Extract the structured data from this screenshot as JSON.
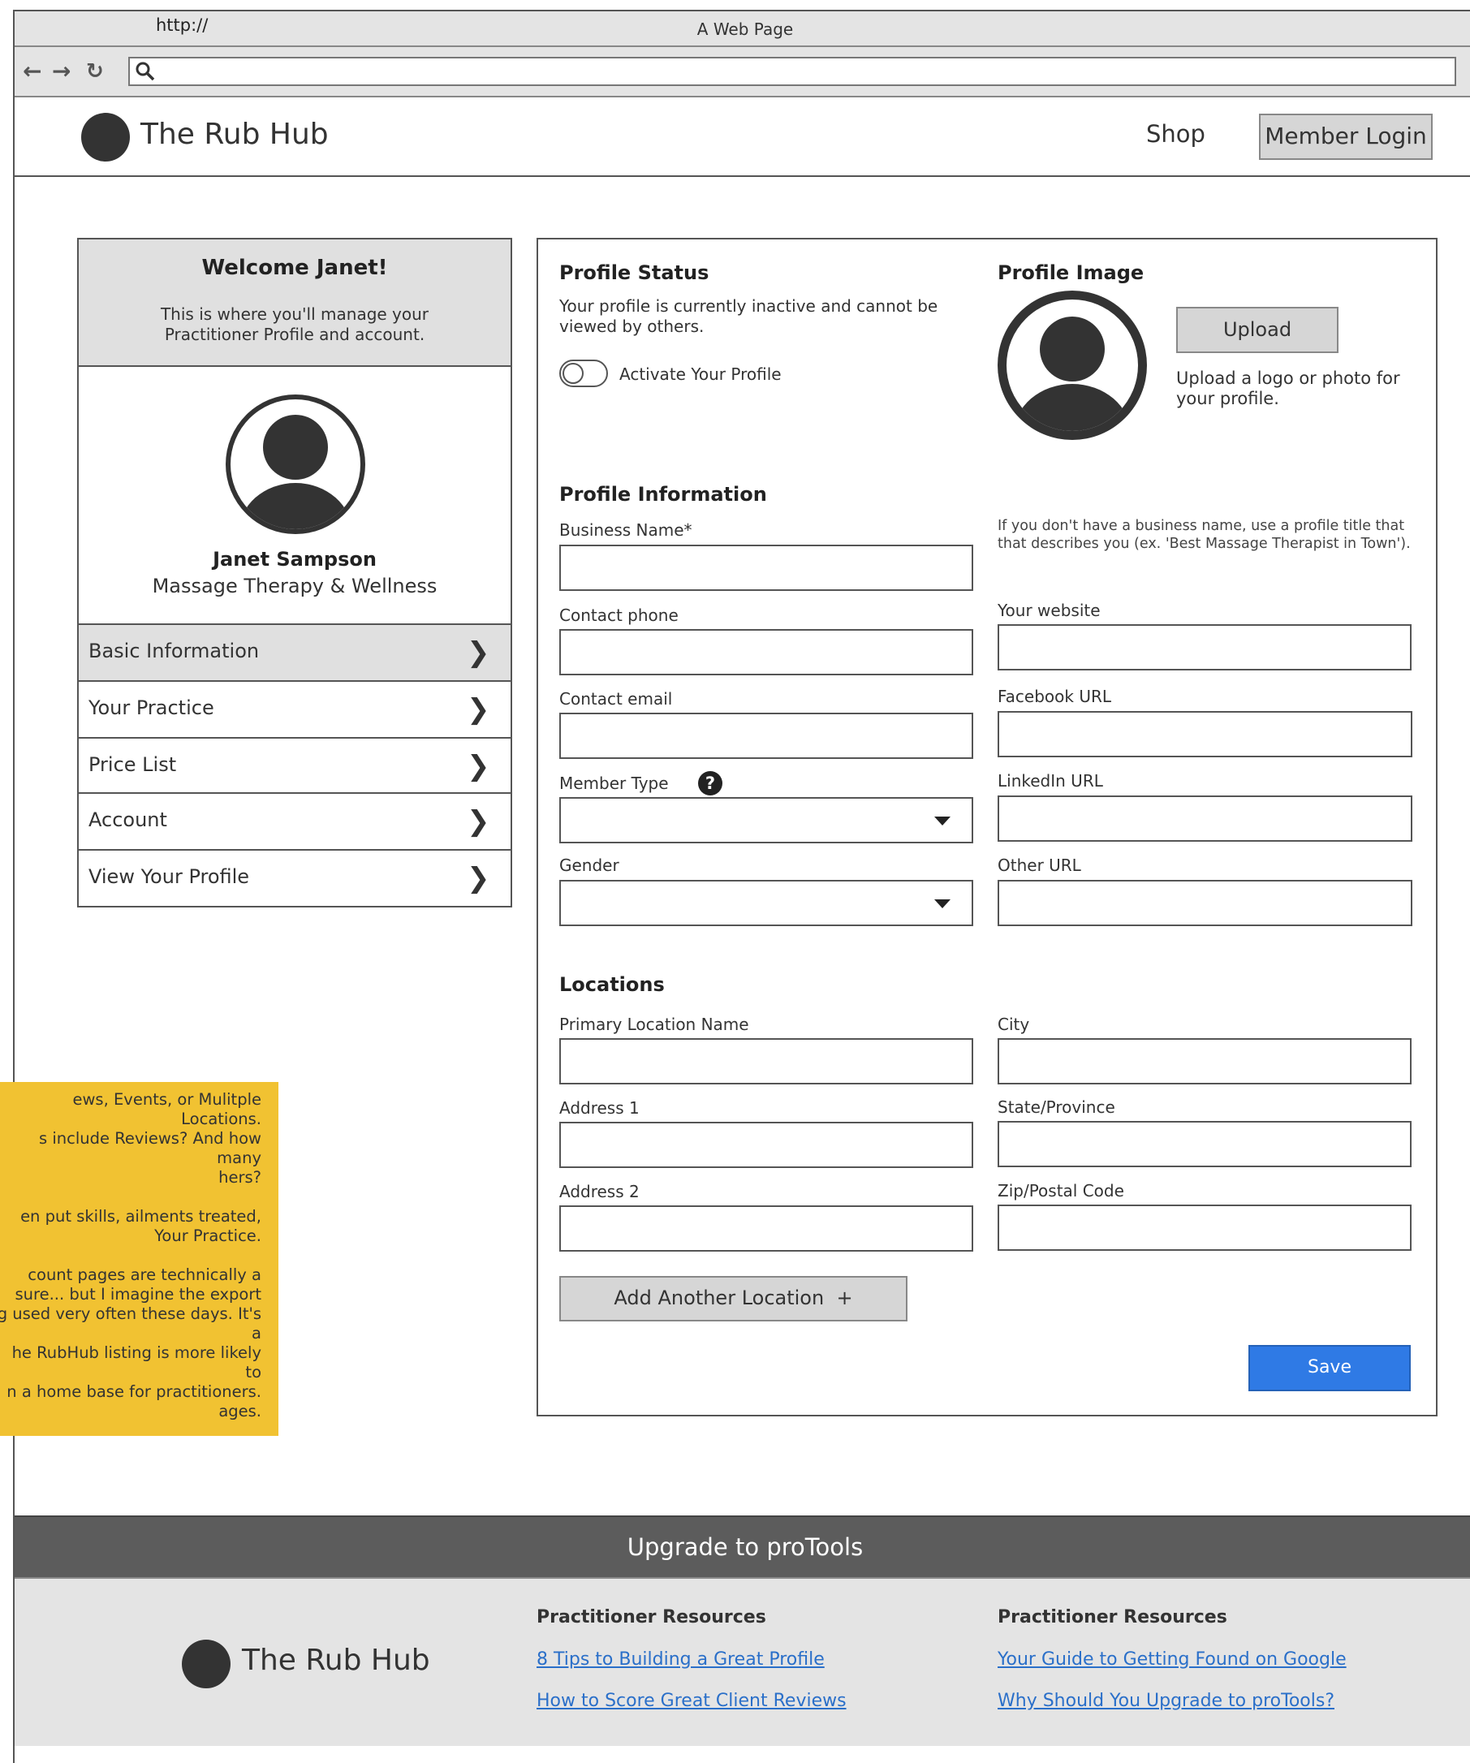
{
  "browser": {
    "title": "A Web Page",
    "url": "http://",
    "back_icon": "arrow-left",
    "forward_icon": "arrow-right",
    "reload_icon": "reload"
  },
  "header": {
    "brand": "The Rub Hub",
    "shop_label": "Shop",
    "login_label": "Member Login"
  },
  "sidebar": {
    "welcome_title": "Welcome Janet!",
    "welcome_text": "This is where you'll manage your Practitioner Profile and account.",
    "name": "Janet Sampson",
    "subtitle": "Massage Therapy & Wellness",
    "items": [
      {
        "label": "Basic Information",
        "active": true
      },
      {
        "label": "Your Practice"
      },
      {
        "label": "Price List"
      },
      {
        "label": "Account"
      },
      {
        "label": "View Your Profile"
      }
    ]
  },
  "profile_status": {
    "heading": "Profile Status",
    "text": "Your profile is currently inactive and cannot be viewed by others.",
    "toggle_label": "Activate Your Profile"
  },
  "profile_image": {
    "heading": "Profile Image",
    "upload_label": "Upload",
    "hint": "Upload a logo or photo for your profile."
  },
  "profile_info": {
    "heading": "Profile Information",
    "business_name_label": "Business Name*",
    "business_hint": "If you don't have a business name, use a profile title that that describes you (ex. 'Best Massage Therapist in Town').",
    "contact_phone_label": "Contact phone",
    "contact_email_label": "Contact email",
    "member_type_label": "Member Type",
    "gender_label": "Gender",
    "website_label": "Your website",
    "facebook_label": "Facebook URL",
    "linkedin_label": "LinkedIn URL",
    "other_label": "Other URL"
  },
  "locations": {
    "heading": "Locations",
    "primary_label": "Primary Location Name",
    "address1_label": "Address 1",
    "address2_label": "Address 2",
    "city_label": "City",
    "state_label": "State/Province",
    "zip_label": "Zip/Postal Code",
    "add_label": "Add Another Location  +"
  },
  "save_label": "Save",
  "sticky_note": "ews, Events, or Mulitple Locations.\ns include Reviews? And how many\nhers?\n\nen put skills, ailments treated,\n Your Practice.\n\ncount pages are technically a\nsure... but I imagine the export\ng used very often these days. It's a\nhe RubHub listing is more likely to\nn a home base for practitioners.\nages.\n\n can add languages and\nription and most profiles don't\nebsite.",
  "footer": {
    "upgrade_label": "Upgrade to proTools",
    "brand": "The Rub Hub",
    "col1_heading": "Practitioner Resources",
    "col1_links": [
      "8 Tips to Building a Great Profile",
      "How to Score Great Client Reviews"
    ],
    "col2_heading": "Practitioner Resources",
    "col2_links": [
      "Your Guide to Getting Found on Google",
      "Why Should You Upgrade to proTools?"
    ]
  }
}
